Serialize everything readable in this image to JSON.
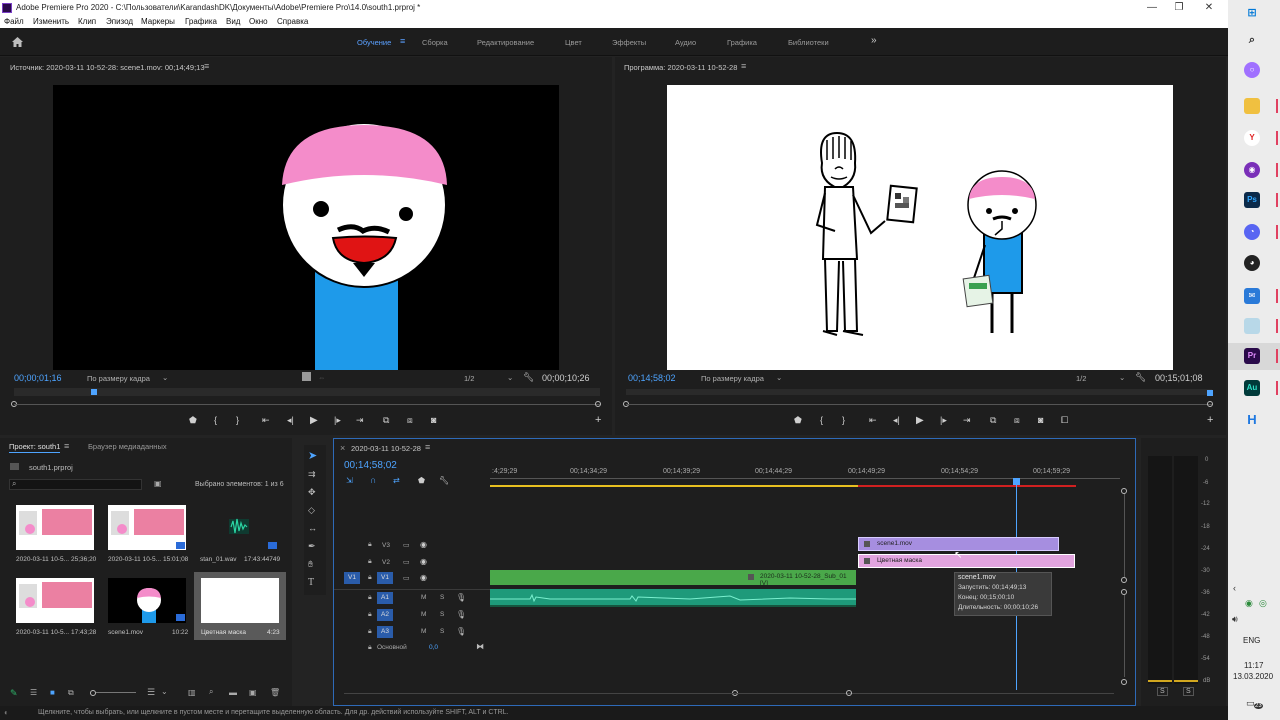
{
  "window": {
    "title": "Adobe Premiere Pro 2020 - C:\\Пользователи\\KarandashDK\\Документы\\Adobe\\Premiere Pro\\14.0\\south1.prproj *",
    "minimize": "—",
    "restore": "❐",
    "close": "✕"
  },
  "menu": [
    "Файл",
    "Изменить",
    "Клип",
    "Эпизод",
    "Маркеры",
    "Графика",
    "Вид",
    "Окно",
    "Справка"
  ],
  "workspaces": [
    "Обучение",
    "Сборка",
    "Редактирование",
    "Цвет",
    "Эффекты",
    "Аудио",
    "Графика",
    "Библиотеки"
  ],
  "workspace_more": "»",
  "source": {
    "header": "Источник: 2020-03-11 10-52-28: scene1.mov: 00;14;49;13",
    "timecode_left": "00;00;01;16",
    "fit": "По размеру кадра",
    "resolution": "1/2",
    "timecode_right": "00;00;10;26"
  },
  "program": {
    "header": "Программа: 2020-03-11 10-52-28",
    "timecode_left": "00;14;58;02",
    "fit": "По размеру кадра",
    "resolution": "1/2",
    "timecode_right": "00;15;01;08"
  },
  "project": {
    "tab_project": "Проект: south1",
    "tab_browser": "Браузер медиаданных",
    "file": "south1.prproj",
    "selected": "Выбрано элементов: 1 из 6",
    "items": [
      {
        "name": "2020-03-11 10-5...",
        "duration": "25;36;20"
      },
      {
        "name": "2020-03-11 10-5...",
        "duration": "15:01;08"
      },
      {
        "name": "stan_01.wav",
        "duration": "17:43:44749"
      },
      {
        "name": "2020-03-11 10-5...",
        "duration": "17:43;28"
      },
      {
        "name": "scene1.mov",
        "duration": "10:22"
      },
      {
        "name": "Цветная маска",
        "duration": "4:23"
      }
    ]
  },
  "timeline": {
    "tab": "2020-03-11 10-52-28",
    "close": "×",
    "playhead_tc": "00;14;58;02",
    "ruler": [
      ":4;29;29",
      "00;14;34;29",
      "00;14;39;29",
      "00;14;44;29",
      "00;14;49;29",
      "00;14;54;29",
      "00;14;59;29"
    ],
    "tracks": {
      "video": [
        "V3",
        "V2",
        "V1"
      ],
      "audio": [
        "A1",
        "A2",
        "A3"
      ],
      "source_v": "V1",
      "mute": "M",
      "solo": "S",
      "master": "Основной",
      "master_val": "0,0"
    },
    "clips": {
      "v3": "scene1.mov",
      "v2": "Цветная маска",
      "v1": "2020-03-11 10-52-28_Sub_01 [V]"
    },
    "tooltip": {
      "name": "scene1.mov",
      "start": "Запустить: 00;14;49;13",
      "end": "Конец: 00;15;00;10",
      "duration": "Длительность: 00;00;10;26"
    }
  },
  "meter": {
    "scale": [
      "0",
      "-6",
      "-12",
      "-18",
      "-24",
      "-30",
      "-36",
      "-42",
      "-48",
      "-54",
      "dB"
    ],
    "solo_left": "S",
    "solo_right": "S"
  },
  "status": "Щелкните, чтобы выбрать, или щелкните в пустом месте и перетащите выделенную область. Для др. действий используйте SHIFT, ALT и CTRL.",
  "tray": {
    "lang": "ENG",
    "time": "11:17",
    "date": "13.03.2020",
    "notif": "23"
  },
  "taskbar_icons": [
    "windows-icon",
    "search-icon",
    "cortana-icon",
    "folder-icon",
    "yandex-icon",
    "tor-icon",
    "photoshop-icon",
    "discord-icon",
    "obs-icon",
    "mail-icon",
    "paper-icon",
    "premiere-icon",
    "audition-icon",
    "h-icon"
  ],
  "colors": {
    "accent": "#4ea4ff",
    "clip_v3": "#a68ee0",
    "clip_v2": "#e2a4df",
    "clip_v1": "#4aa84a",
    "clip_audio": "#1e9a7a",
    "ruler_yellow": "#e8c020",
    "ruler_red": "#d02020",
    "skin_pink": "#f48cca",
    "shirt_blue": "#1e9aea"
  }
}
